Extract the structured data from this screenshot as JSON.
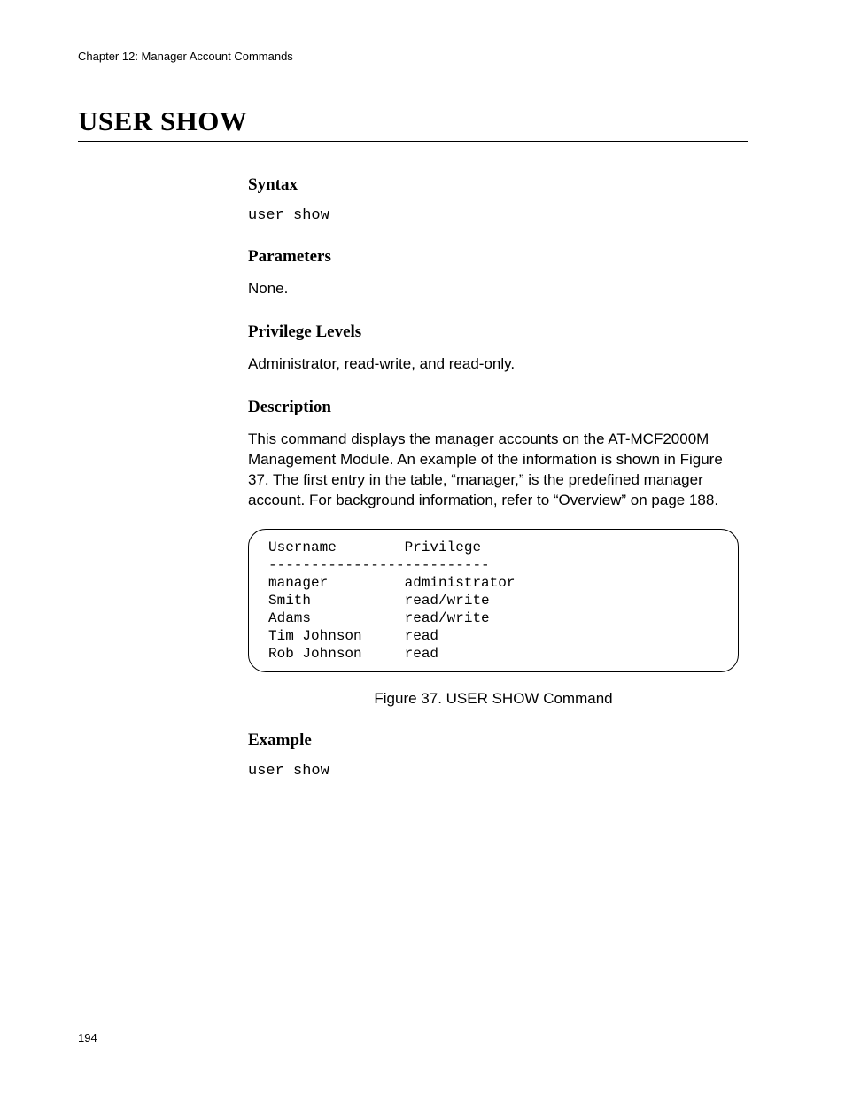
{
  "header": {
    "running_head": "Chapter 12: Manager Account Commands"
  },
  "title": "USER SHOW",
  "sections": {
    "syntax": {
      "heading": "Syntax",
      "code": "user show"
    },
    "parameters": {
      "heading": "Parameters",
      "text": "None."
    },
    "privilege": {
      "heading": "Privilege Levels",
      "text": "Administrator, read-write, and read-only."
    },
    "description": {
      "heading": "Description",
      "text": "This command displays the manager accounts on the AT-MCF2000M Management Module. An example of the information is shown in Figure 37. The first entry in the table, “manager,” is the predefined manager account. For background information, refer to “Overview” on page 188."
    },
    "output": {
      "text": "Username        Privilege\n--------------------------\nmanager         administrator\nSmith           read/write\nAdams           read/write\nTim Johnson     read\nRob Johnson     read"
    },
    "figure_caption": "Figure 37. USER SHOW Command",
    "example": {
      "heading": "Example",
      "code": "user show"
    }
  },
  "footer": {
    "page_number": "194"
  }
}
